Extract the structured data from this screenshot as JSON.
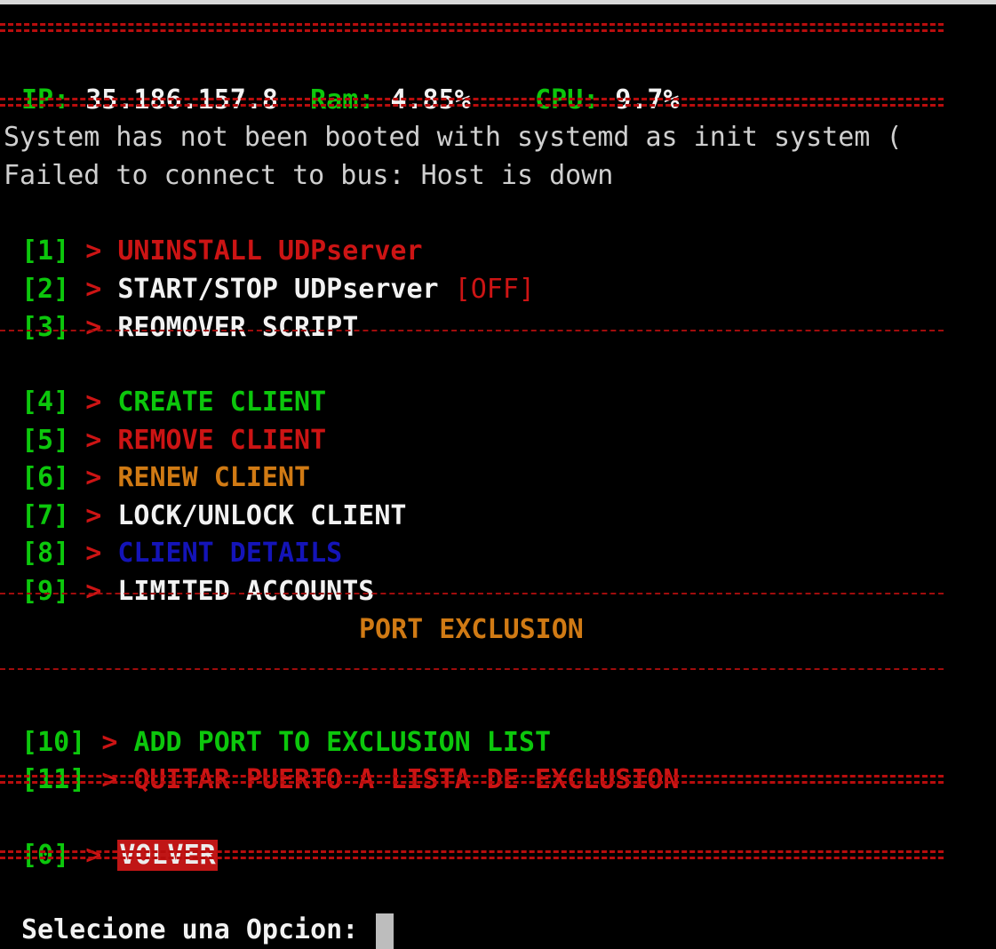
{
  "header": {
    "ip_label": "IP:",
    "ip_value": "35.186.157.8",
    "ram_label": "Ram:",
    "ram_value": "4.85%",
    "cpu_label": "CPU:",
    "cpu_value": "9.7%"
  },
  "messages": [
    "System has not been booted with systemd as init system (",
    "Failed to connect to bus: Host is down"
  ],
  "arrow": ">",
  "menu": {
    "items": [
      {
        "num": "[1]",
        "label": "UNINSTALL UDPserver",
        "color": "#cc1414"
      },
      {
        "num": "[2]",
        "label": "START/STOP UDPserver",
        "status": "[OFF]",
        "color": "#f2f2f2"
      },
      {
        "num": "[3]",
        "label": "REOMOVER SCRIPT",
        "color": "#f2f2f2"
      },
      {
        "num": "[4]",
        "label": "CREATE CLIENT",
        "color": "#0cc70c"
      },
      {
        "num": "[5]",
        "label": "REMOVE CLIENT",
        "color": "#cc1414"
      },
      {
        "num": "[6]",
        "label": "RENEW CLIENT",
        "color": "#d07a14"
      },
      {
        "num": "[7]",
        "label": "LOCK/UNLOCK CLIENT",
        "color": "#f2f2f2"
      },
      {
        "num": "[8]",
        "label": "CLIENT DETAILS",
        "color": "#1414b8"
      },
      {
        "num": "[9]",
        "label": "LIMITED ACCOUNTS",
        "color": "#f2f2f2"
      },
      {
        "num": "[10]",
        "label": "ADD PORT TO EXCLUSION LIST",
        "color": "#0cc70c"
      },
      {
        "num": "[11]",
        "label": "QUITAR PUERTO A LISTA DE EXCLUSION",
        "color": "#cc1414"
      },
      {
        "num": "[0]",
        "label": "VOLVER",
        "color": "#ececec"
      }
    ]
  },
  "section_title": "PORT EXCLUSION",
  "prompt": "Selecione una Opcion:",
  "colors": {
    "background": "#000000",
    "green": "#0cc70c",
    "red": "#cc1414",
    "orange": "#d07a14",
    "blue": "#1414b8",
    "separator": "#b80d0d"
  }
}
